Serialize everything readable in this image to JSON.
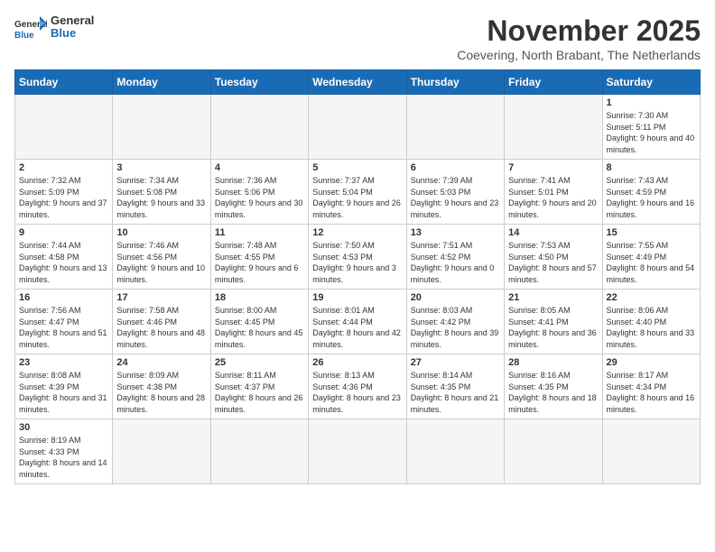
{
  "header": {
    "logo_general": "General",
    "logo_blue": "Blue",
    "month_year": "November 2025",
    "location": "Coevering, North Brabant, The Netherlands"
  },
  "weekdays": [
    "Sunday",
    "Monday",
    "Tuesday",
    "Wednesday",
    "Thursday",
    "Friday",
    "Saturday"
  ],
  "weeks": [
    [
      {
        "day": "",
        "info": ""
      },
      {
        "day": "",
        "info": ""
      },
      {
        "day": "",
        "info": ""
      },
      {
        "day": "",
        "info": ""
      },
      {
        "day": "",
        "info": ""
      },
      {
        "day": "",
        "info": ""
      },
      {
        "day": "1",
        "info": "Sunrise: 7:30 AM\nSunset: 5:11 PM\nDaylight: 9 hours and 40 minutes."
      }
    ],
    [
      {
        "day": "2",
        "info": "Sunrise: 7:32 AM\nSunset: 5:09 PM\nDaylight: 9 hours and 37 minutes."
      },
      {
        "day": "3",
        "info": "Sunrise: 7:34 AM\nSunset: 5:08 PM\nDaylight: 9 hours and 33 minutes."
      },
      {
        "day": "4",
        "info": "Sunrise: 7:36 AM\nSunset: 5:06 PM\nDaylight: 9 hours and 30 minutes."
      },
      {
        "day": "5",
        "info": "Sunrise: 7:37 AM\nSunset: 5:04 PM\nDaylight: 9 hours and 26 minutes."
      },
      {
        "day": "6",
        "info": "Sunrise: 7:39 AM\nSunset: 5:03 PM\nDaylight: 9 hours and 23 minutes."
      },
      {
        "day": "7",
        "info": "Sunrise: 7:41 AM\nSunset: 5:01 PM\nDaylight: 9 hours and 20 minutes."
      },
      {
        "day": "8",
        "info": "Sunrise: 7:43 AM\nSunset: 4:59 PM\nDaylight: 9 hours and 16 minutes."
      }
    ],
    [
      {
        "day": "9",
        "info": "Sunrise: 7:44 AM\nSunset: 4:58 PM\nDaylight: 9 hours and 13 minutes."
      },
      {
        "day": "10",
        "info": "Sunrise: 7:46 AM\nSunset: 4:56 PM\nDaylight: 9 hours and 10 minutes."
      },
      {
        "day": "11",
        "info": "Sunrise: 7:48 AM\nSunset: 4:55 PM\nDaylight: 9 hours and 6 minutes."
      },
      {
        "day": "12",
        "info": "Sunrise: 7:50 AM\nSunset: 4:53 PM\nDaylight: 9 hours and 3 minutes."
      },
      {
        "day": "13",
        "info": "Sunrise: 7:51 AM\nSunset: 4:52 PM\nDaylight: 9 hours and 0 minutes."
      },
      {
        "day": "14",
        "info": "Sunrise: 7:53 AM\nSunset: 4:50 PM\nDaylight: 8 hours and 57 minutes."
      },
      {
        "day": "15",
        "info": "Sunrise: 7:55 AM\nSunset: 4:49 PM\nDaylight: 8 hours and 54 minutes."
      }
    ],
    [
      {
        "day": "16",
        "info": "Sunrise: 7:56 AM\nSunset: 4:47 PM\nDaylight: 8 hours and 51 minutes."
      },
      {
        "day": "17",
        "info": "Sunrise: 7:58 AM\nSunset: 4:46 PM\nDaylight: 8 hours and 48 minutes."
      },
      {
        "day": "18",
        "info": "Sunrise: 8:00 AM\nSunset: 4:45 PM\nDaylight: 8 hours and 45 minutes."
      },
      {
        "day": "19",
        "info": "Sunrise: 8:01 AM\nSunset: 4:44 PM\nDaylight: 8 hours and 42 minutes."
      },
      {
        "day": "20",
        "info": "Sunrise: 8:03 AM\nSunset: 4:42 PM\nDaylight: 8 hours and 39 minutes."
      },
      {
        "day": "21",
        "info": "Sunrise: 8:05 AM\nSunset: 4:41 PM\nDaylight: 8 hours and 36 minutes."
      },
      {
        "day": "22",
        "info": "Sunrise: 8:06 AM\nSunset: 4:40 PM\nDaylight: 8 hours and 33 minutes."
      }
    ],
    [
      {
        "day": "23",
        "info": "Sunrise: 8:08 AM\nSunset: 4:39 PM\nDaylight: 8 hours and 31 minutes."
      },
      {
        "day": "24",
        "info": "Sunrise: 8:09 AM\nSunset: 4:38 PM\nDaylight: 8 hours and 28 minutes."
      },
      {
        "day": "25",
        "info": "Sunrise: 8:11 AM\nSunset: 4:37 PM\nDaylight: 8 hours and 26 minutes."
      },
      {
        "day": "26",
        "info": "Sunrise: 8:13 AM\nSunset: 4:36 PM\nDaylight: 8 hours and 23 minutes."
      },
      {
        "day": "27",
        "info": "Sunrise: 8:14 AM\nSunset: 4:35 PM\nDaylight: 8 hours and 21 minutes."
      },
      {
        "day": "28",
        "info": "Sunrise: 8:16 AM\nSunset: 4:35 PM\nDaylight: 8 hours and 18 minutes."
      },
      {
        "day": "29",
        "info": "Sunrise: 8:17 AM\nSunset: 4:34 PM\nDaylight: 8 hours and 16 minutes."
      }
    ],
    [
      {
        "day": "30",
        "info": "Sunrise: 8:19 AM\nSunset: 4:33 PM\nDaylight: 8 hours and 14 minutes."
      },
      {
        "day": "",
        "info": ""
      },
      {
        "day": "",
        "info": ""
      },
      {
        "day": "",
        "info": ""
      },
      {
        "day": "",
        "info": ""
      },
      {
        "day": "",
        "info": ""
      },
      {
        "day": "",
        "info": ""
      }
    ]
  ]
}
